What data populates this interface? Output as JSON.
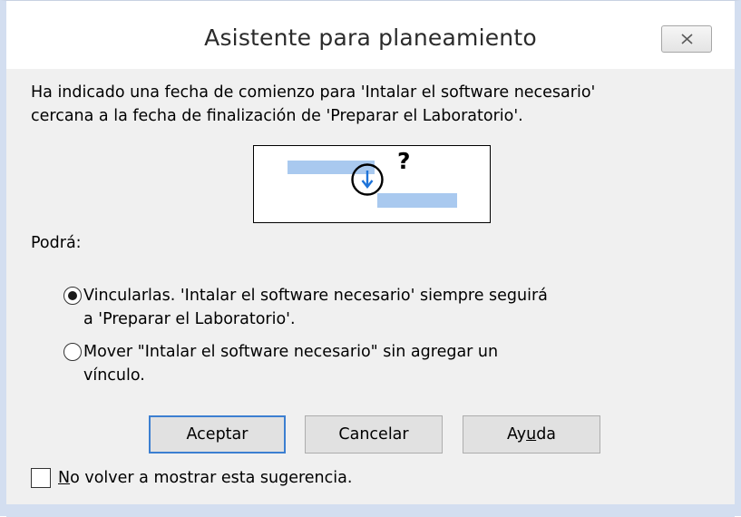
{
  "window": {
    "title": "Asistente para planeamiento"
  },
  "message": {
    "line1": "Ha indicado una fecha de comienzo para 'Intalar el software necesario'",
    "line2": "cercana a la fecha de finalización de 'Preparar el Laboratorio'."
  },
  "illustration": {
    "question_mark": "?",
    "bar_color": "#a9c9ef",
    "arrow_color": "#1e73d8"
  },
  "options": {
    "heading": "Podrá:",
    "link": {
      "line1": "Vincularlas. 'Intalar el software necesario' siempre seguirá",
      "line2": "a 'Preparar el Laboratorio'.",
      "checked": true
    },
    "move": {
      "line1": "Mover \"Intalar el software necesario\" sin agregar un",
      "line2": "vínculo.",
      "checked": false
    }
  },
  "buttons": {
    "ok": "Aceptar",
    "cancel": "Cancelar",
    "help_prefix": "Ay",
    "help_mnemonic": "u",
    "help_suffix": "da"
  },
  "dont_show": {
    "mnemonic": "N",
    "rest": "o volver a mostrar esta sugerencia.",
    "checked": false
  },
  "colors": {
    "accent": "#3c7fd1",
    "dialog_bg": "#f0f0f0",
    "frame": "#d3def0"
  }
}
